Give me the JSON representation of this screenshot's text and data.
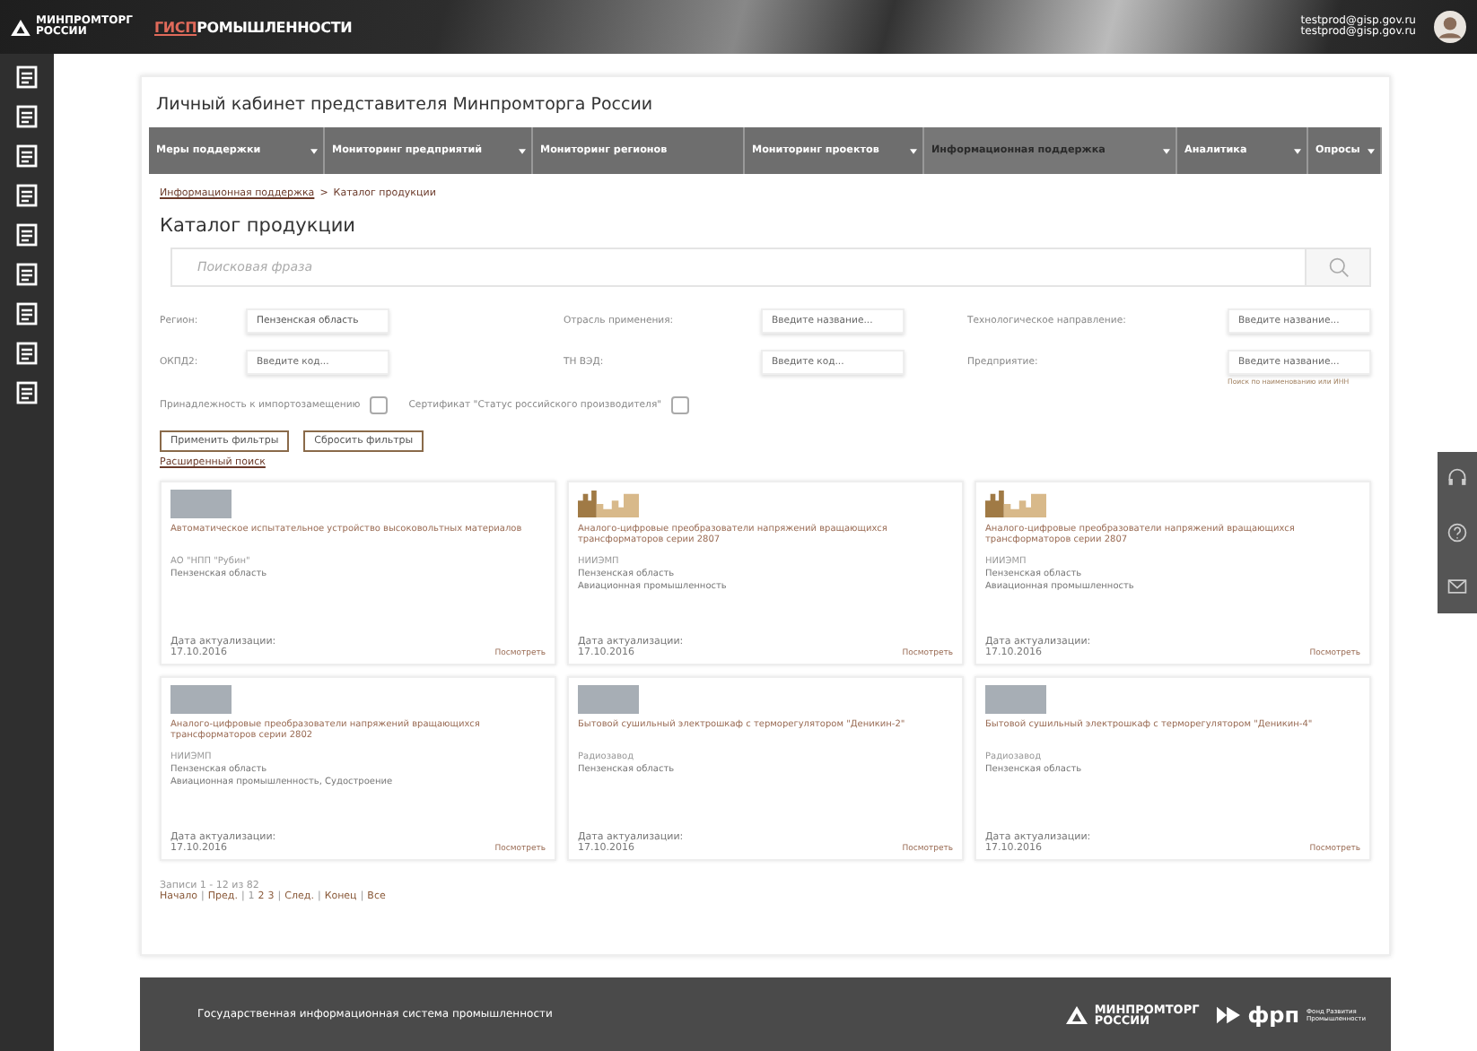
{
  "header": {
    "logo": [
      "МИНПРОМТОРГ",
      "РОССИИ"
    ],
    "brand_highlight": "ГИСП",
    "brand_rest": "РОМЫШЛЕННОСТИ",
    "user_emails": [
      "testprod@gisp.gov.ru",
      "testprod@gisp.gov.ru"
    ]
  },
  "page_title": "Личный кабинет представителя Минпромторга России",
  "nav": [
    {
      "label": "Меры поддержки",
      "dropdown": true,
      "selected": false
    },
    {
      "label": "Мониторинг предприятий",
      "dropdown": true,
      "selected": false
    },
    {
      "label": "Мониторинг регионов",
      "dropdown": false,
      "selected": false
    },
    {
      "label": "Мониторинг проектов",
      "dropdown": true,
      "selected": false
    },
    {
      "label": "Информационная поддержка",
      "dropdown": true,
      "selected": true
    },
    {
      "label": "Аналитика",
      "dropdown": true,
      "selected": false
    },
    {
      "label": "Опросы",
      "dropdown": true,
      "selected": false
    }
  ],
  "breadcrumbs": [
    "Информационная поддержка",
    "Каталог продукции"
  ],
  "breadcrumb_separator": ">",
  "heading": "Каталог продукции",
  "search": {
    "placeholder": "Поисковая фраза"
  },
  "filters": [
    {
      "label": "Регион:",
      "value": "Пензенская область"
    },
    {
      "label": "Отрасль применения:",
      "placeholder": "Введите название..."
    },
    {
      "label": "Технологическое направление:",
      "placeholder": "Введите название..."
    },
    {
      "label": "ОКПД2:",
      "placeholder": "Введите код..."
    },
    {
      "label": "ТН ВЭД:",
      "placeholder": "Введите код..."
    },
    {
      "label": "Предприятие:",
      "placeholder": "Введите название...",
      "hint": "Поиск по наименованию или ИНН"
    }
  ],
  "checkboxes": [
    {
      "label": "Принадлежность к импортозамещению",
      "checked": false
    },
    {
      "label": "Сертификат \"Статус российского производителя\"",
      "checked": false
    }
  ],
  "buttons": [
    "Применить фильтры",
    "Сбросить фильтры"
  ],
  "advanced_link": "Расширенный поиск",
  "products": [
    {
      "kind": "photo",
      "name": "Автоматическое испытательное устройство высоковольтных материалов",
      "company": "АО \"НПП \"Рубин\"",
      "details": [
        "Пензенская область"
      ],
      "date_label": "Дата актуализации:",
      "date": "17.10.2016",
      "link": "Посмотреть"
    },
    {
      "kind": "logo",
      "name": "Аналого-цифровые преобразователи напряжений вращающихся трансформаторов серии 2807",
      "company": "НИИЭМП",
      "details": [
        "Пензенская область",
        "Авиационная промышленность"
      ],
      "date_label": "Дата актуализации:",
      "date": "17.10.2016",
      "link": "Посмотреть"
    },
    {
      "kind": "logo",
      "name": "Аналого-цифровые преобразователи напряжений вращающихся трансформаторов серии 2807",
      "company": "НИИЭМП",
      "details": [
        "Пензенская область",
        "Авиационная промышленность"
      ],
      "date_label": "Дата актуализации:",
      "date": "17.10.2016",
      "link": "Посмотреть"
    },
    {
      "kind": "photo",
      "name": "Аналого-цифровые преобразователи напряжений вращающихся трансформаторов серии 2802",
      "company": "НИИЭМП",
      "details": [
        "Пензенская область",
        "Авиационная промышленность, Судостроение"
      ],
      "date_label": "Дата актуализации:",
      "date": "17.10.2016",
      "link": "Посмотреть"
    },
    {
      "kind": "photo",
      "name": "Бытовой сушильный электрошкаф с терморегулятором \"Деникин-2\"",
      "company": "Радиозавод",
      "details": [
        "Пензенская область"
      ],
      "date_label": "Дата актуализации:",
      "date": "17.10.2016",
      "link": "Посмотреть"
    },
    {
      "kind": "photo",
      "name": "Бытовой сушильный электрошкаф с терморегулятором \"Деникин-4\"",
      "company": "Радиозавод",
      "details": [
        "Пензенская область"
      ],
      "date_label": "Дата актуализации:",
      "date": "17.10.2016",
      "link": "Посмотреть"
    }
  ],
  "records": "Записи 1 - 12 из 82",
  "pagination": [
    {
      "kind": "link",
      "label": "Начало"
    },
    {
      "kind": "sep",
      "label": "|"
    },
    {
      "kind": "link",
      "label": "Пред."
    },
    {
      "kind": "sep",
      "label": "|"
    },
    {
      "kind": "page",
      "label": "1",
      "selected": true
    },
    {
      "kind": "page",
      "label": "2",
      "selected": false
    },
    {
      "kind": "page",
      "label": "3",
      "selected": false
    },
    {
      "kind": "sep",
      "label": "|"
    },
    {
      "kind": "link",
      "label": "След."
    },
    {
      "kind": "sep",
      "label": "|"
    },
    {
      "kind": "link",
      "label": "Конец"
    },
    {
      "kind": "sep",
      "label": "|"
    },
    {
      "kind": "link",
      "label": "Все"
    }
  ],
  "footer": {
    "text": "Государственная информационная система промышленности",
    "logo": [
      "МИНПРОМТОРГ",
      "РОССИИ"
    ],
    "frp": "фрп",
    "frp_sub": [
      "Фонд Развития",
      "Промышленности"
    ]
  }
}
